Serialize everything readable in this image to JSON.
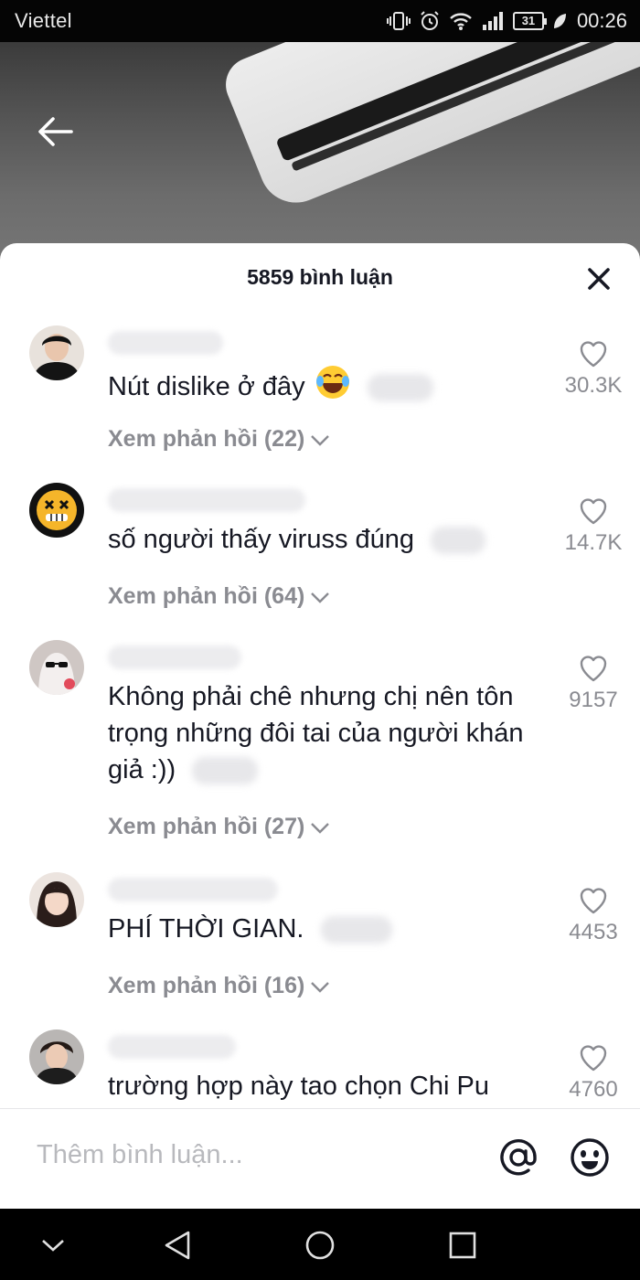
{
  "status_bar": {
    "carrier": "Viettel",
    "battery": "31",
    "time": "00:26"
  },
  "sheet": {
    "title": "5859 bình luận",
    "comments": [
      {
        "text": "Nút dislike ở đây",
        "replies": "Xem phản hồi (22)",
        "likes": "30.3K"
      },
      {
        "text": "số người thấy viruss đúng",
        "replies": "Xem phản hồi (64)",
        "likes": "14.7K"
      },
      {
        "text": "Không phải chê nhưng chị nên tôn trọng những đôi tai của người khán giả :))",
        "replies": "Xem phản hồi (27)",
        "likes": "9157"
      },
      {
        "text": "PHÍ THỜI GIAN.",
        "replies": "Xem phản hồi (16)",
        "likes": "4453"
      },
      {
        "text": "trường hợp này tao chọn Chi Pu",
        "likes": "4760"
      }
    ]
  },
  "input": {
    "placeholder": "Thêm bình luận..."
  },
  "colors": {
    "text": "#161823",
    "secondary": "#8a8b91",
    "placeholder": "#b8b9bd"
  },
  "icons": [
    "back-arrow-icon",
    "close-icon",
    "heart-icon",
    "chevron-down-icon",
    "at-icon",
    "emoji-icon",
    "nav-back-icon",
    "nav-home-icon",
    "nav-recents-icon",
    "nav-collapse-icon"
  ]
}
